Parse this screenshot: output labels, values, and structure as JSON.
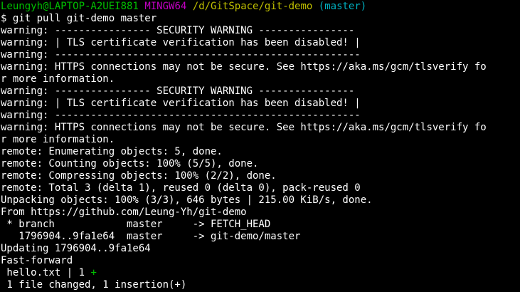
{
  "colors": {
    "background": "#000000",
    "text": "#ffffff",
    "user_host": "#00c000",
    "system": "#c000c0",
    "path": "#c0c000",
    "branch": "#00b0c0",
    "insertion_plus": "#00c000"
  },
  "prompt": {
    "user_host": "Leungyh@LAPTOP-A2UEI881",
    "system": "MINGW64",
    "path": "/d/GitSpace/git-demo",
    "branch": "(master)"
  },
  "command": {
    "symbol": "$",
    "text": "git pull git-demo master"
  },
  "output": {
    "lines": [
      "warning: ---------------- SECURITY WARNING ----------------",
      "warning: | TLS certificate verification has been disabled! |",
      "warning: ---------------------------------------------------",
      "warning: HTTPS connections may not be secure. See https://aka.ms/gcm/tlsverify fo",
      "r more information.",
      "warning: ---------------- SECURITY WARNING ----------------",
      "warning: | TLS certificate verification has been disabled! |",
      "warning: ---------------------------------------------------",
      "warning: HTTPS connections may not be secure. See https://aka.ms/gcm/tlsverify fo",
      "r more information.",
      "remote: Enumerating objects: 5, done.",
      "remote: Counting objects: 100% (5/5), done.",
      "remote: Compressing objects: 100% (2/2), done.",
      "remote: Total 3 (delta 1), reused 0 (delta 0), pack-reused 0",
      "Unpacking objects: 100% (3/3), 646 bytes | 215.00 KiB/s, done.",
      "From https://github.com/Leung-Yh/git-demo",
      " * branch            master     -> FETCH_HEAD",
      "   1796904..9fa1e64  master     -> git-demo/master",
      "Updating 1796904..9fa1e64",
      "Fast-forward"
    ],
    "diffstat_file": " hello.txt | 1 ",
    "diffstat_plus": "+",
    "summary": " 1 file changed, 1 insertion(+)"
  }
}
